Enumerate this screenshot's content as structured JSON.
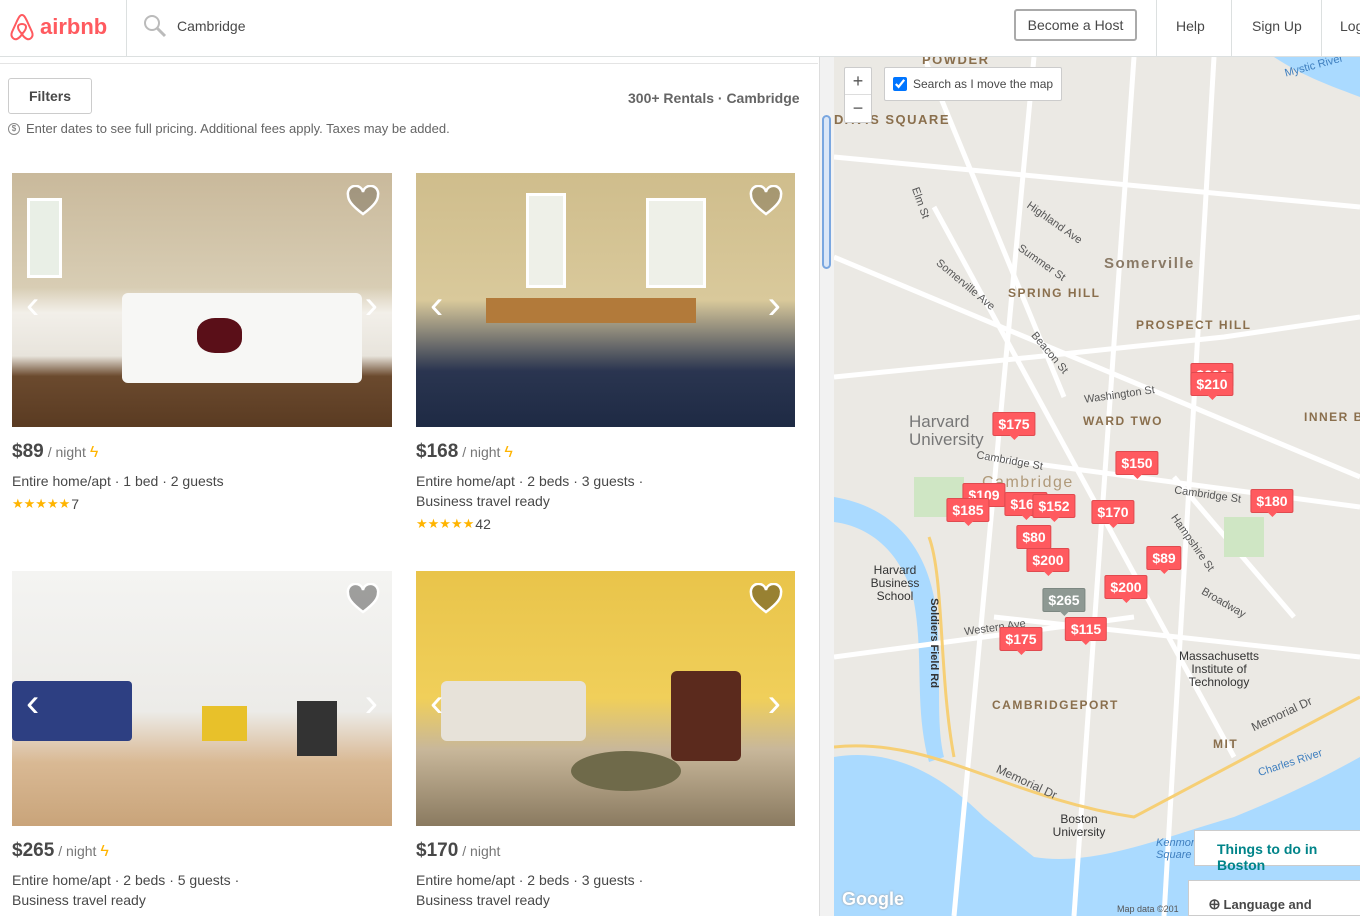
{
  "header": {
    "logo": "airbnb",
    "search_value": "Cambridge",
    "become_host": "Become a Host",
    "help": "Help",
    "sign_up": "Sign Up",
    "log_in": "Log"
  },
  "results": {
    "filters_label": "Filters",
    "count": "300+ Rentals · Cambridge",
    "pricing_note": "Enter dates to see full pricing. Additional fees apply. Taxes may be added."
  },
  "listings": [
    {
      "price": "$89",
      "per": "/ night",
      "instant_book": true,
      "desc": "Entire home/apt · 1 bed · 2 guests",
      "desc2": "",
      "stars": "★★★★★",
      "reviews": "7"
    },
    {
      "price": "$168",
      "per": "/ night",
      "instant_book": true,
      "desc": "Entire home/apt · 2 beds · 3 guests ·",
      "desc2": "Business travel ready",
      "stars": "★★★★★",
      "reviews": "42"
    },
    {
      "price": "$265",
      "per": "/ night",
      "instant_book": true,
      "desc": "Entire home/apt · 2 beds · 5 guests ·",
      "desc2": "Business travel ready"
    },
    {
      "price": "$170",
      "per": "/ night",
      "instant_book": false,
      "desc": "Entire home/apt · 2 beds · 3 guests ·",
      "desc2": "Business travel ready"
    }
  ],
  "map": {
    "search_as_move": "Search as I move the map",
    "search_as_move_checked": true,
    "zoom_in": "+",
    "zoom_out": "−",
    "things_to_do": "Things to do in Boston",
    "language": "Language and currency",
    "attribution": "Map data ©201",
    "google": "Google",
    "pins": [
      "$200",
      "$210",
      "$175",
      "$150",
      "$109",
      "$185",
      "$168",
      "$152",
      "$170",
      "$180",
      "$80",
      "$200",
      "$89",
      "$200",
      "$265",
      "$115",
      "$175"
    ],
    "labels": {
      "powder": "POWDER",
      "square": "DAVIS SQUARE",
      "somerville": "Somerville",
      "spring_hill": "SPRING HILL",
      "prospect_hill": "PROSPECT HILL",
      "harvard": "Harvard University",
      "ward_two": "WARD TWO",
      "cambridge": "Cambridge",
      "hbs": "Harvard Business School",
      "mit": "Massachusetts Institute of Technology",
      "cambridgeport": "CAMBRIDGEPORT",
      "bu": "Boston University",
      "charles": "Charles River",
      "mystic": "Mystic River",
      "inner": "INNER B",
      "cambridge_st": "Cambridge St",
      "broadway": "Broadway",
      "memorial": "Memorial Dr",
      "washington": "Washington St",
      "hampshire": "Hampshire St",
      "western": "Western Ave",
      "soldiers": "Soldiers Field Rd",
      "highland": "Highland Ave",
      "summer": "Summer St",
      "somerville_ave": "Somerville Ave",
      "elm": "Elm St",
      "beacon": "Beacon St",
      "kenmore": "Kenmore Square",
      "mit_short": "MIT"
    }
  },
  "colors": {
    "brand": "#ff5a5f",
    "teal": "#008489",
    "star": "#ffb400"
  }
}
